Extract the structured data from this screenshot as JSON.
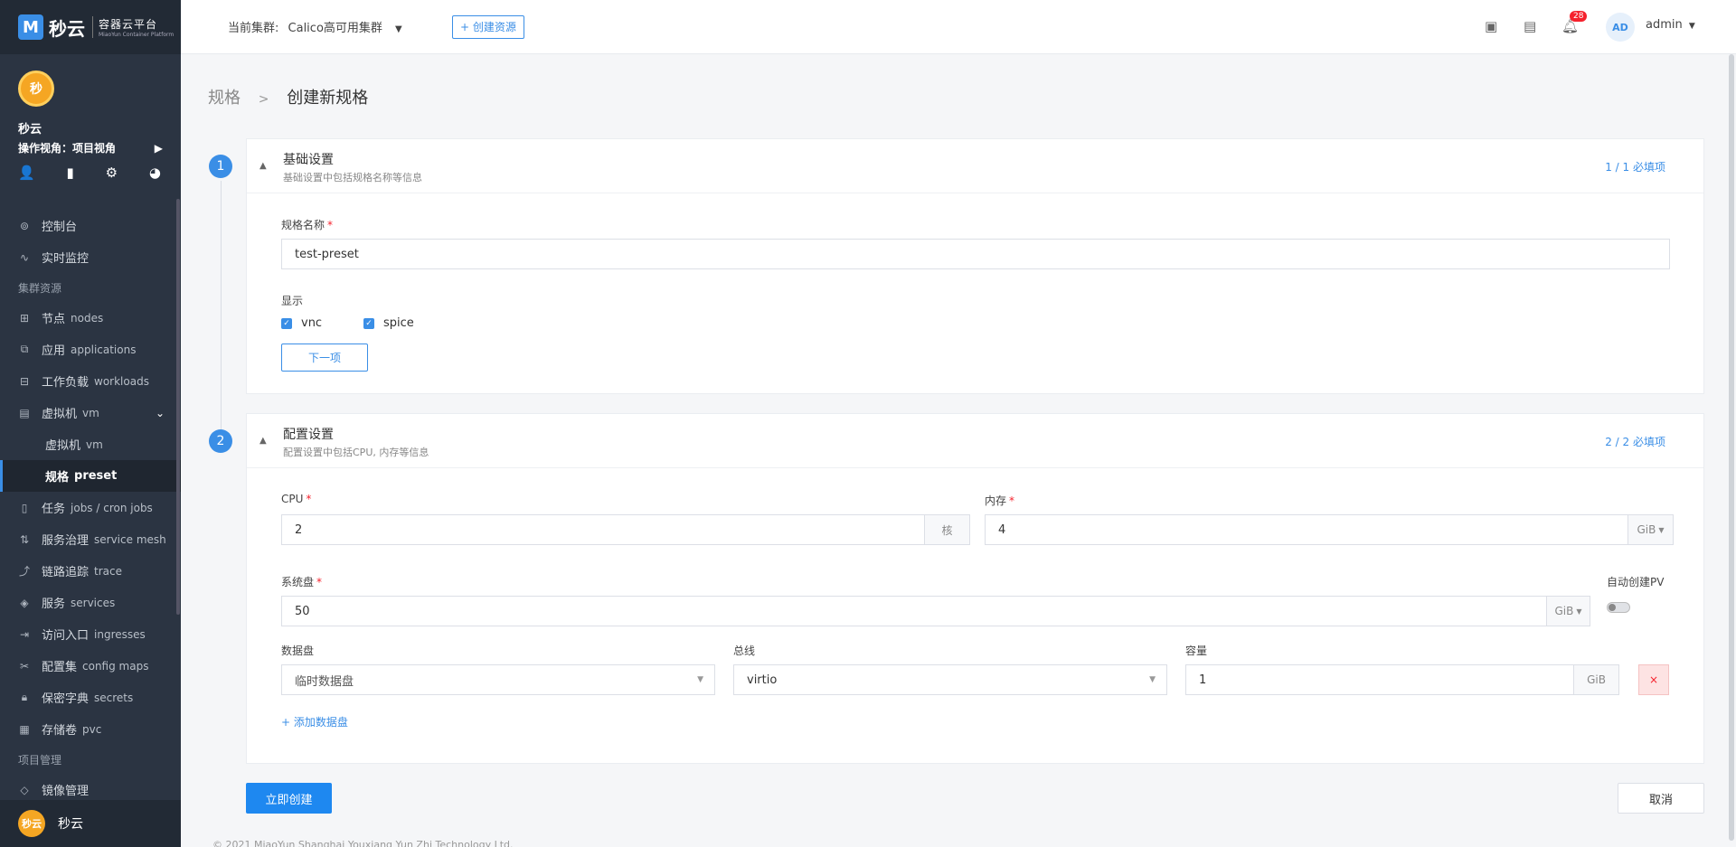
{
  "logo": {
    "mark": "M",
    "name": "秒云",
    "title": "容器云平台",
    "subtitle": "MiaoYun Container Platform"
  },
  "project": {
    "avatar_text": "秒",
    "name": "秒云",
    "view_label": "操作视角：项目视角",
    "icons": [
      "user-icon",
      "bar-chart-icon",
      "gear-icon",
      "pie-chart-icon"
    ]
  },
  "nav": {
    "console": "控制台",
    "monitor": "实时监控",
    "section_cluster": "集群资源",
    "nodes": {
      "zh": "节点",
      "en": "nodes"
    },
    "applications": {
      "zh": "应用",
      "en": "applications"
    },
    "workloads": {
      "zh": "工作负载",
      "en": "workloads"
    },
    "vm": {
      "zh": "虚拟机",
      "en": "vm"
    },
    "vm_sub": {
      "zh": "虚拟机",
      "en": "vm"
    },
    "preset": {
      "zh": "规格",
      "en": "preset"
    },
    "jobs": {
      "zh": "任务",
      "en": "jobs / cron jobs"
    },
    "mesh": {
      "zh": "服务治理",
      "en": "service mesh"
    },
    "trace": {
      "zh": "链路追踪",
      "en": "trace"
    },
    "services": {
      "zh": "服务",
      "en": "services"
    },
    "ingresses": {
      "zh": "访问入口",
      "en": "ingresses"
    },
    "configmaps": {
      "zh": "配置集",
      "en": "config maps"
    },
    "secrets": {
      "zh": "保密字典",
      "en": "secrets"
    },
    "pvc": {
      "zh": "存储卷",
      "en": "pvc"
    },
    "section_project": "项目管理",
    "images": "镜像管理"
  },
  "footer_user": {
    "avatar_text": "秒云",
    "name": "秒云"
  },
  "topbar": {
    "cluster_label": "当前集群:",
    "cluster_value": "Calico高可用集群",
    "create_button": "+ 创建资源",
    "notification_count": "28",
    "avatar": "AD",
    "username": "admin"
  },
  "breadcrumb": {
    "parent": "规格",
    "separator": ">",
    "current": "创建新规格"
  },
  "step1": {
    "number": "1",
    "title": "基础设置",
    "subtitle": "基础设置中包括规格名称等信息",
    "required": "1 / 1 必填项",
    "name_label": "规格名称",
    "name_value": "test-preset",
    "display_label": "显示",
    "options": [
      {
        "label": "vnc",
        "checked": true
      },
      {
        "label": "spice",
        "checked": true
      }
    ],
    "next_button": "下一项"
  },
  "step2": {
    "number": "2",
    "title": "配置设置",
    "subtitle": "配置设置中包括CPU, 内存等信息",
    "required": "2 / 2 必填项",
    "cpu_label": "CPU",
    "cpu_value": "2",
    "cpu_unit": "核",
    "mem_label": "内存",
    "mem_value": "4",
    "mem_unit": "GiB",
    "sysdisk_label": "系统盘",
    "sysdisk_value": "50",
    "sysdisk_unit": "GiB",
    "auto_pv_label": "自动创建PV",
    "auto_pv_on": false,
    "datadisk_label": "数据盘",
    "datadisk_value": "临时数据盘",
    "bus_label": "总线",
    "bus_value": "virtio",
    "capacity_label": "容量",
    "capacity_value": "1",
    "capacity_unit": "GiB",
    "delete_glyph": "×",
    "add_disk_link": "+ 添加数据盘"
  },
  "actions": {
    "create": "立即创建",
    "cancel": "取消"
  },
  "footer_text": "© 2021 MiaoYun Shanghai Youxiang Yun Zhi Technology Ltd."
}
